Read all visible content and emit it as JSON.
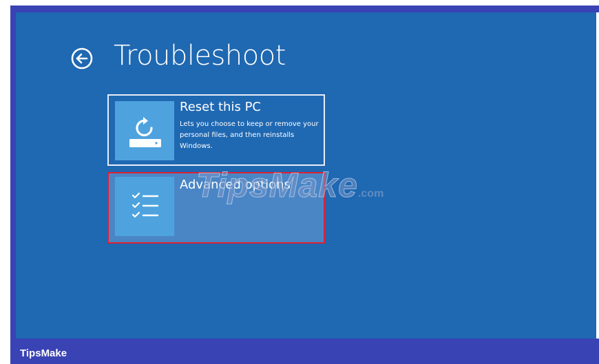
{
  "window": {
    "title": "Troubleshoot"
  },
  "header": {
    "back_icon": "back-arrow-circle-icon"
  },
  "options": [
    {
      "label": "Reset this PC",
      "description": "Lets you choose to keep or remove your personal files, and then reinstalls Windows.",
      "icon": "reset-pc-icon",
      "highlighted": false
    },
    {
      "label": "Advanced options",
      "description": "",
      "icon": "checklist-icon",
      "highlighted": true
    }
  ],
  "watermark": {
    "text": "TipsMake",
    "suffix": ".com"
  },
  "footer": {
    "brand": "TipsMake"
  },
  "colors": {
    "background": "#1f68b2",
    "tile": "#4ea3de",
    "selected_option": "#4a86c6",
    "highlight_border": "#e02030",
    "frame": "#3a43b4"
  }
}
